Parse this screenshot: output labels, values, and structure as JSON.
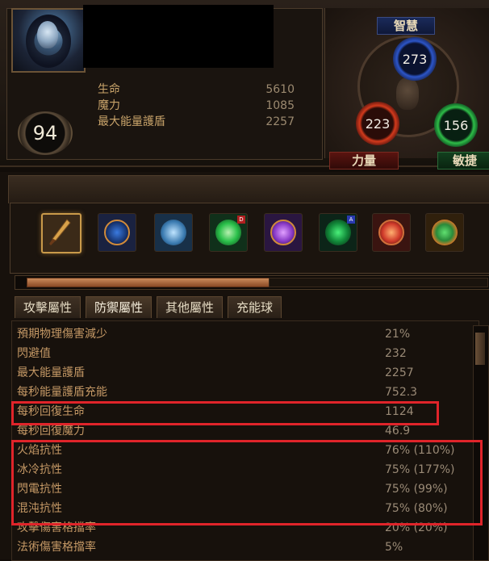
{
  "character": {
    "level": "94",
    "stats": [
      {
        "label": "生命",
        "value": "5610"
      },
      {
        "label": "魔力",
        "value": "1085"
      },
      {
        "label": "最大能量護盾",
        "value": "2257"
      }
    ]
  },
  "attributes": {
    "intelligence": {
      "label": "智慧",
      "value": "273",
      "color": "#2c55c8"
    },
    "strength": {
      "label": "力量",
      "value": "223",
      "color": "#d33a1c"
    },
    "dexterity": {
      "label": "敏捷",
      "value": "156",
      "color": "#2ebd48"
    }
  },
  "gems": [
    {
      "name": "dagger-icon",
      "color": "#c9923a"
    },
    {
      "name": "leap-slam-icon",
      "color": "#2a6ad0"
    },
    {
      "name": "flicker-strike-icon",
      "color": "#3a8ad0"
    },
    {
      "name": "vaal-gem-icon",
      "color": "#3ac04a"
    },
    {
      "name": "arcane-orb-icon",
      "color": "#8a3ac8"
    },
    {
      "name": "ghost-figure-icon",
      "color": "#2ab05a"
    },
    {
      "name": "fire-ring-icon",
      "color": "#d03a2a"
    },
    {
      "name": "nature-fire-icon",
      "color": "#d0782a"
    }
  ],
  "tabs": [
    "攻擊屬性",
    "防禦屬性",
    "其他屬性",
    "充能球"
  ],
  "defense_stats": [
    {
      "label": "預期物理傷害減少",
      "value": "21%"
    },
    {
      "label": "閃避值",
      "value": "232"
    },
    {
      "label": "最大能量護盾",
      "value": "2257"
    },
    {
      "label": "每秒能量護盾充能",
      "value": "752.3"
    },
    {
      "label": "每秒回復生命",
      "value": "1124"
    },
    {
      "label": "每秒回復魔力",
      "value": "46.9"
    },
    {
      "label": "火焰抗性",
      "value": "76% (110%)"
    },
    {
      "label": "冰冷抗性",
      "value": "75% (177%)"
    },
    {
      "label": "閃電抗性",
      "value": "75% (99%)"
    },
    {
      "label": "混沌抗性",
      "value": "75% (80%)"
    },
    {
      "label": "攻擊傷害格擋率",
      "value": "20% (20%)"
    },
    {
      "label": "法術傷害格擋率",
      "value": "5%"
    }
  ],
  "highlight_color": "#e0242a"
}
